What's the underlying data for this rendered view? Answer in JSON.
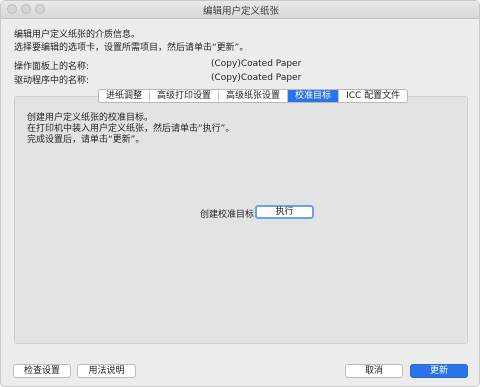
{
  "window": {
    "title": "编辑用户定义纸张"
  },
  "intro": {
    "line1": "编辑用户定义纸张的介质信息。",
    "line2": "选择要编辑的选项卡，设置所需项目，然后请单击“更新”。"
  },
  "fields": {
    "panel_name_label": "操作面板上的名称:",
    "panel_name_value": "(Copy)Coated Paper",
    "driver_name_label": "驱动程序中的名称:",
    "driver_name_value": "(Copy)Coated Paper"
  },
  "tabs": [
    {
      "label": "进纸调整",
      "active": false
    },
    {
      "label": "高级打印设置",
      "active": false
    },
    {
      "label": "高级纸张设置",
      "active": false
    },
    {
      "label": "校准目标",
      "active": true
    },
    {
      "label": "ICC 配置文件",
      "active": false
    }
  ],
  "panel": {
    "line1": "创建用户定义纸张的校准目标。",
    "line2": "在打印机中装入用户定义纸张，然后请单击“执行”。",
    "line3": "完成设置后，请单击“更新”。",
    "target_label": "创建校准目标:",
    "execute_label": "执行"
  },
  "footer": {
    "check_settings": "检查设置",
    "how_to_use": "用法说明",
    "cancel": "取消",
    "update": "更新"
  },
  "colors": {
    "accent": "#2a73e8",
    "window_bg": "#ececec",
    "panel_bg": "#e3e3e3"
  }
}
